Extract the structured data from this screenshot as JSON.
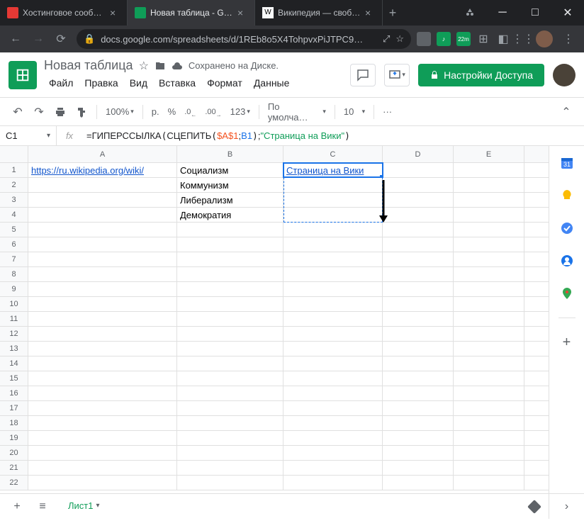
{
  "browser": {
    "tabs": [
      {
        "title": "Хостинговое сообщес",
        "active": false
      },
      {
        "title": "Новая таблица - Goog",
        "active": true
      },
      {
        "title": "Википедия — свободн",
        "active": false
      }
    ],
    "url": "docs.google.com/spreadsheets/d/1REb8o5X4TohpvxPiJTPC9…",
    "ext_badge": "22m"
  },
  "doc": {
    "title": "Новая таблица",
    "save_status": "Сохранено на Диске.",
    "menus": [
      "Файл",
      "Правка",
      "Вид",
      "Вставка",
      "Формат",
      "Данные"
    ],
    "share_label": "Настройки Доступа"
  },
  "toolbar": {
    "zoom": "100%",
    "currency": "р.",
    "percent": "%",
    "dec_less": ".0",
    "dec_more": ".00",
    "num_fmt": "123",
    "font": "По умолча…",
    "font_size": "10",
    "more": "···"
  },
  "formula": {
    "cell_ref": "C1",
    "fx": "fx",
    "parts": {
      "eq": "=",
      "fn1": "ГИПЕРССЫЛКА",
      "fn2": "СЦЕПИТЬ",
      "ref1": "$A$1",
      "sep": ";",
      "ref2": "B1",
      "str": "\"Страница на Вики\""
    }
  },
  "grid": {
    "cols": [
      "A",
      "B",
      "C",
      "D",
      "E"
    ],
    "rows": [
      {
        "n": 1,
        "a": "https://ru.wikipedia.org/wiki/",
        "b": "Социализм",
        "c": "Страница на Вики"
      },
      {
        "n": 2,
        "b": "Коммунизм"
      },
      {
        "n": 3,
        "b": "Либерализм"
      },
      {
        "n": 4,
        "b": "Демократия"
      },
      {
        "n": 5
      },
      {
        "n": 6
      },
      {
        "n": 7
      },
      {
        "n": 8
      },
      {
        "n": 9
      },
      {
        "n": 10
      },
      {
        "n": 11
      },
      {
        "n": 12
      },
      {
        "n": 13
      },
      {
        "n": 14
      },
      {
        "n": 15
      },
      {
        "n": 16
      },
      {
        "n": 17
      },
      {
        "n": 18
      },
      {
        "n": 19
      },
      {
        "n": 20
      },
      {
        "n": 21
      },
      {
        "n": 22
      }
    ]
  },
  "sheets": {
    "tab_name": "Лист1"
  }
}
